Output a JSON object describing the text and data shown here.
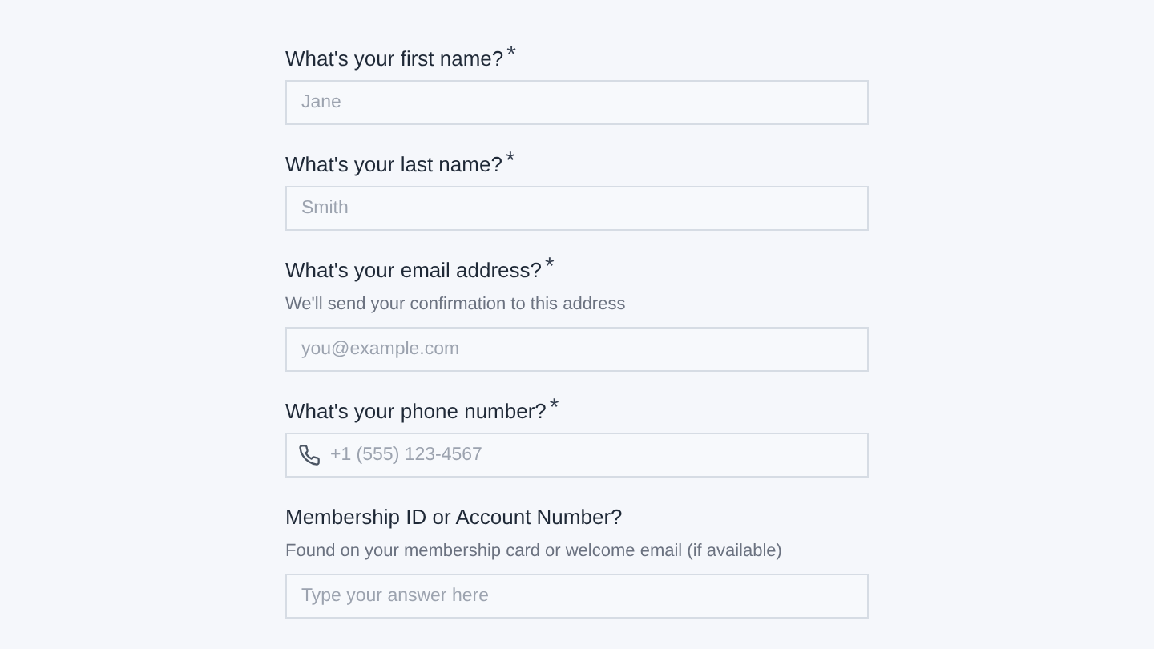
{
  "fields": [
    {
      "kind": "text",
      "label": "What's your first name?",
      "required_mark": "*",
      "placeholder": "Jane"
    },
    {
      "kind": "text",
      "label": "What's your last name?",
      "required_mark": "*",
      "placeholder": "Smith"
    },
    {
      "kind": "text",
      "label": "What's your email address?",
      "required_mark": "*",
      "hint": "We'll send your confirmation to this address",
      "placeholder": "you@example.com"
    },
    {
      "kind": "phone",
      "label": "What's your phone number?",
      "required_mark": "*",
      "placeholder": "+1 (555) 123-4567"
    },
    {
      "kind": "text",
      "label": "Membership ID or Account Number?",
      "hint": "Found on your membership card or welcome email (if available)",
      "placeholder": "Type your answer here"
    }
  ]
}
